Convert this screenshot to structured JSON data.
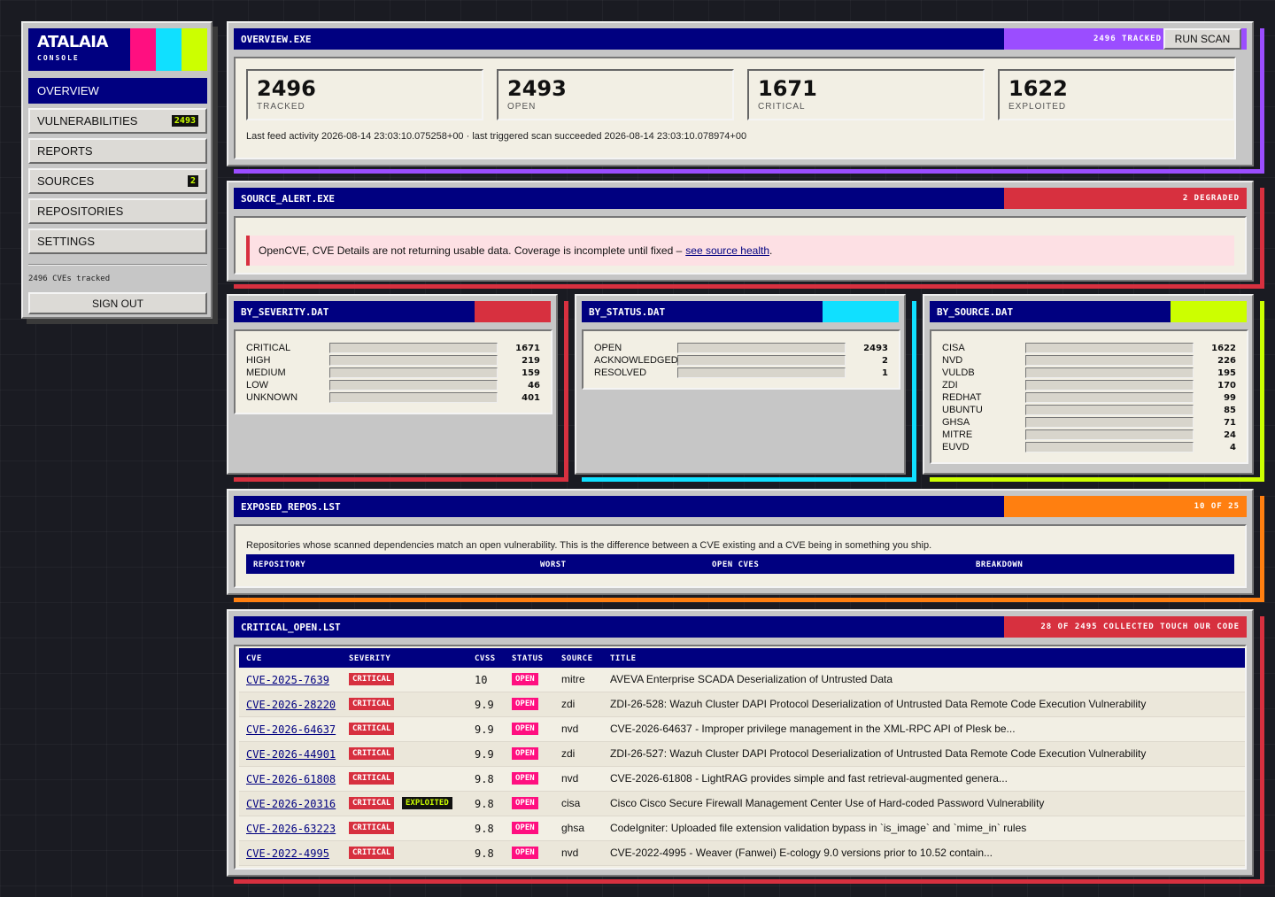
{
  "sidebar": {
    "brand": "ATALAIA",
    "brand_sub": "CONSOLE",
    "swatches": [
      "#ff0f80",
      "#10e0ff",
      "#ccff00"
    ],
    "nav": [
      {
        "label": "OVERVIEW",
        "active": true
      },
      {
        "label": "VULNERABILITIES",
        "badge": "2493"
      },
      {
        "label": "REPORTS"
      },
      {
        "label": "SOURCES",
        "badge": "2"
      },
      {
        "label": "REPOSITORIES"
      },
      {
        "label": "SETTINGS"
      }
    ],
    "count_text": "2496 CVEs tracked",
    "signout": "SIGN OUT"
  },
  "overview": {
    "title": "OVERVIEW.EXE",
    "badge": "2496 TRACKED",
    "accent": "#9b4dff",
    "run_scan": "RUN SCAN",
    "stats": [
      {
        "value": "2496",
        "label": "TRACKED"
      },
      {
        "value": "2493",
        "label": "OPEN"
      },
      {
        "value": "1671",
        "label": "CRITICAL"
      },
      {
        "value": "1622",
        "label": "EXPLOITED"
      }
    ],
    "feed": "Last feed activity 2026-08-14 23:03:10.075258+00 · last triggered scan succeeded 2026-08-14 23:03:10.078974+00"
  },
  "source_alert": {
    "title": "SOURCE_ALERT.EXE",
    "badge": "2 DEGRADED",
    "accent": "#d7303f",
    "message": "OpenCVE, CVE Details are not returning usable data. Coverage is incomplete until fixed –",
    "link": "see source health",
    "suffix": "."
  },
  "by_severity": {
    "title": "BY_SEVERITY.DAT",
    "accent": "#d7303f",
    "rows": [
      {
        "label": "CRITICAL",
        "value": "1671"
      },
      {
        "label": "HIGH",
        "value": "219"
      },
      {
        "label": "MEDIUM",
        "value": "159"
      },
      {
        "label": "LOW",
        "value": "46"
      },
      {
        "label": "UNKNOWN",
        "value": "401"
      }
    ]
  },
  "by_status": {
    "title": "BY_STATUS.DAT",
    "accent": "#10e0ff",
    "rows": [
      {
        "label": "OPEN",
        "value": "2493"
      },
      {
        "label": "ACKNOWLEDGED",
        "value": "2"
      },
      {
        "label": "RESOLVED",
        "value": "1"
      }
    ]
  },
  "by_source": {
    "title": "BY_SOURCE.DAT",
    "accent": "#ccff00",
    "rows": [
      {
        "label": "CISA",
        "value": "1622"
      },
      {
        "label": "NVD",
        "value": "226"
      },
      {
        "label": "VULDB",
        "value": "195"
      },
      {
        "label": "ZDI",
        "value": "170"
      },
      {
        "label": "REDHAT",
        "value": "99"
      },
      {
        "label": "UBUNTU",
        "value": "85"
      },
      {
        "label": "GHSA",
        "value": "71"
      },
      {
        "label": "MITRE",
        "value": "24"
      },
      {
        "label": "EUVD",
        "value": "4"
      }
    ]
  },
  "exposed_repos": {
    "title": "EXPOSED_REPOS.LST",
    "badge": "10 OF 25",
    "accent": "#ff7f10",
    "description": "Repositories whose scanned dependencies match an open vulnerability. This is the difference between a CVE existing and a CVE being in something you ship.",
    "columns": [
      "REPOSITORY",
      "WORST",
      "OPEN CVES",
      "BREAKDOWN"
    ]
  },
  "critical_open": {
    "title": "CRITICAL_OPEN.LST",
    "badge": "28 OF 2495 COLLECTED TOUCH OUR CODE",
    "accent": "#d7303f",
    "columns": [
      "CVE",
      "SEVERITY",
      "CVSS",
      "STATUS",
      "SOURCE",
      "TITLE"
    ],
    "rows": [
      {
        "cve": "CVE-2025-7639",
        "severity": "CRITICAL",
        "exploited": "",
        "cvss": "10",
        "status": "OPEN",
        "source": "mitre",
        "title": "AVEVA Enterprise SCADA Deserialization of Untrusted Data"
      },
      {
        "cve": "CVE-2026-28220",
        "severity": "CRITICAL",
        "exploited": "",
        "cvss": "9.9",
        "status": "OPEN",
        "source": "zdi",
        "title": "ZDI-26-528: Wazuh Cluster DAPI Protocol Deserialization of Untrusted Data Remote Code Execution Vulnerability"
      },
      {
        "cve": "CVE-2026-64637",
        "severity": "CRITICAL",
        "exploited": "",
        "cvss": "9.9",
        "status": "OPEN",
        "source": "nvd",
        "title": "CVE-2026-64637 - Improper privilege management in the XML-RPC API of Plesk be..."
      },
      {
        "cve": "CVE-2026-44901",
        "severity": "CRITICAL",
        "exploited": "",
        "cvss": "9.9",
        "status": "OPEN",
        "source": "zdi",
        "title": "ZDI-26-527: Wazuh Cluster DAPI Protocol Deserialization of Untrusted Data Remote Code Execution Vulnerability"
      },
      {
        "cve": "CVE-2026-61808",
        "severity": "CRITICAL",
        "exploited": "",
        "cvss": "9.8",
        "status": "OPEN",
        "source": "nvd",
        "title": "CVE-2026-61808 - LightRAG provides simple and fast retrieval-augmented genera..."
      },
      {
        "cve": "CVE-2026-20316",
        "severity": "CRITICAL",
        "exploited": "EXPLOITED",
        "cvss": "9.8",
        "status": "OPEN",
        "source": "cisa",
        "title": "Cisco Cisco Secure Firewall Management Center Use of Hard-coded Password Vulnerability"
      },
      {
        "cve": "CVE-2026-63223",
        "severity": "CRITICAL",
        "exploited": "",
        "cvss": "9.8",
        "status": "OPEN",
        "source": "ghsa",
        "title": "CodeIgniter: Uploaded file extension validation bypass in `is_image` and `mime_in` rules"
      },
      {
        "cve": "CVE-2022-4995",
        "severity": "CRITICAL",
        "exploited": "",
        "cvss": "9.8",
        "status": "OPEN",
        "source": "nvd",
        "title": "CVE-2022-4995 - Weaver (Fanwei) E-cology 9.0 versions prior to 10.52 contain..."
      }
    ]
  }
}
